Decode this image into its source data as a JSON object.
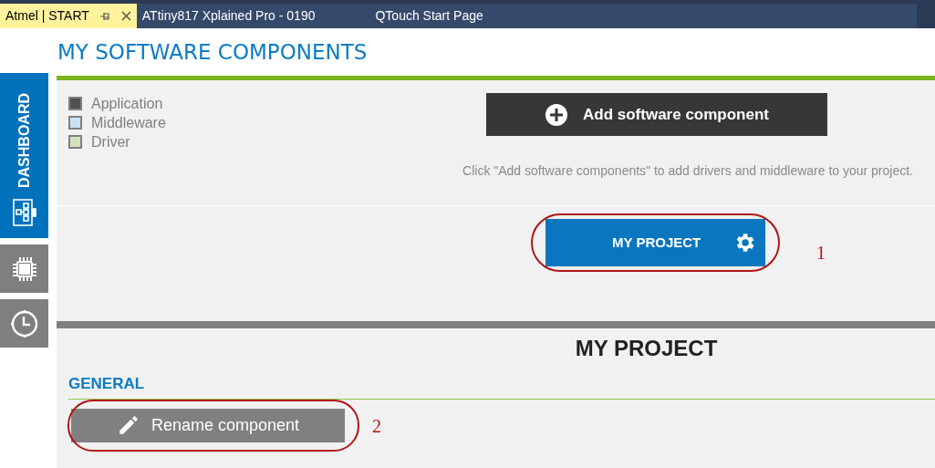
{
  "tabs": [
    {
      "label": "Atmel | START",
      "selected": true
    },
    {
      "label": "ATtiny817 Xplained Pro - 0190",
      "selected": false
    },
    {
      "label": "QTouch Start Page",
      "selected": false
    }
  ],
  "sidebar": {
    "items": [
      {
        "kind": "dashboard",
        "label": "DASHBOARD",
        "selected": true
      },
      {
        "kind": "chip",
        "selected": false
      },
      {
        "kind": "clock",
        "selected": false
      }
    ]
  },
  "title": "MY SOFTWARE COMPONENTS",
  "legend": [
    {
      "label": "Application",
      "color": "#505050"
    },
    {
      "label": "Middleware",
      "color": "#c9e3f5"
    },
    {
      "label": "Driver",
      "color": "#d5e3bd"
    }
  ],
  "add_button": "Add software component",
  "hint": "Click \"Add software components\" to add drivers and middleware to your project.",
  "project_button": "MY PROJECT",
  "project_heading": "MY PROJECT",
  "section": "GENERAL",
  "rename_button": "Rename component",
  "callouts": [
    "1",
    "2"
  ]
}
